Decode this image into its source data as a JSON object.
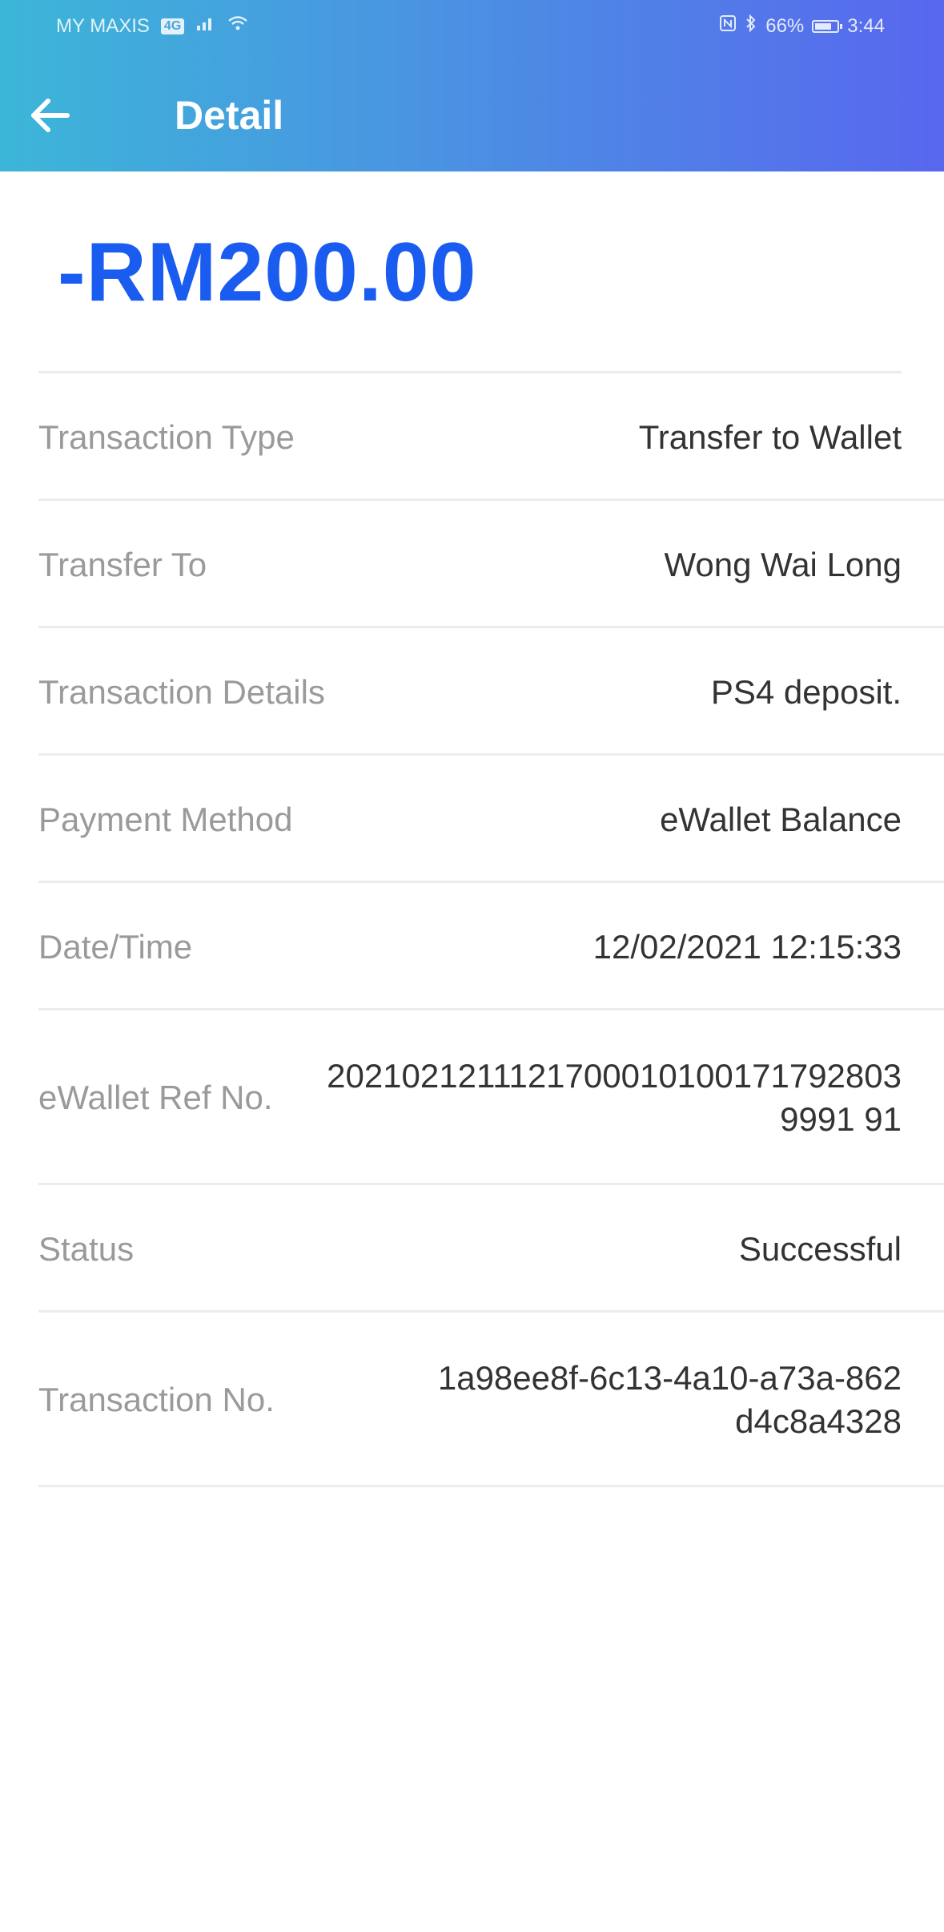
{
  "status_bar": {
    "left_text": "MY MAXIS",
    "network_badge": "4G",
    "right_text": "66%",
    "time": "3:44"
  },
  "header": {
    "title": "Detail",
    "back_icon": "arrow-left-icon"
  },
  "amount": "-RM200.00",
  "details": [
    {
      "label": "Transaction Type",
      "value": "Transfer to Wallet"
    },
    {
      "label": "Transfer To",
      "value": "Wong Wai Long"
    },
    {
      "label": "Transaction Details",
      "value": "PS4 deposit."
    },
    {
      "label": "Payment Method",
      "value": "eWallet Balance"
    },
    {
      "label": "Date/Time",
      "value": "12/02/2021 12:15:33"
    },
    {
      "label": "eWallet Ref No.",
      "value": "20210212111217000101001717928039991 91"
    },
    {
      "label": "Status",
      "value": "Successful"
    },
    {
      "label": "Transaction No.",
      "value": "1a98ee8f-6c13-4a10-a73a-862d4c8a4328"
    }
  ],
  "colors": {
    "header_gradient_start": "#3cb6d8",
    "header_gradient_end": "#5867ee",
    "amount": "#1b5cf0",
    "label": "#9a9a9a",
    "value": "#333333"
  }
}
